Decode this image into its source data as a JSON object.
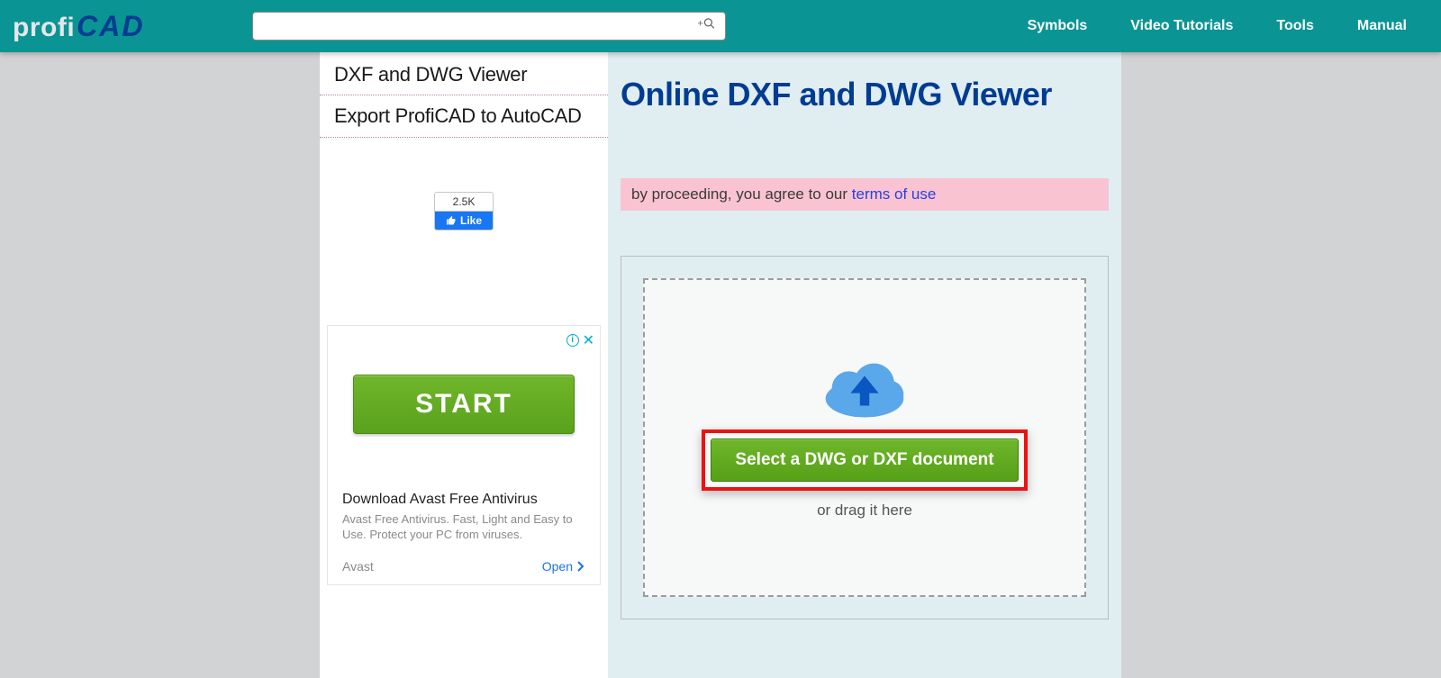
{
  "logo": {
    "part1": "profi",
    "part2": "CAD"
  },
  "search": {
    "placeholder": "",
    "icon_label": "+Q"
  },
  "nav": {
    "items": [
      {
        "label": "Symbols"
      },
      {
        "label": "Video Tutorials"
      },
      {
        "label": "Tools"
      },
      {
        "label": "Manual"
      }
    ]
  },
  "sidebar": {
    "items": [
      {
        "label": "DXF and DWG Viewer"
      },
      {
        "label": "Export ProfiCAD to AutoCAD"
      }
    ],
    "like": {
      "count": "2.5K",
      "label": "Like"
    }
  },
  "ad": {
    "start_label": "START",
    "title": "Download Avast Free Antivirus",
    "desc": "Avast Free Antivirus. Fast, Light and Easy to Use. Protect your PC from viruses.",
    "brand": "Avast",
    "open_label": "Open"
  },
  "main": {
    "title": "Online DXF and DWG Viewer",
    "notice_prefix": "by proceeding, you agree to our ",
    "notice_link": "terms of use",
    "select_label": "Select a DWG or DXF document",
    "drag_label": "or drag it here"
  }
}
